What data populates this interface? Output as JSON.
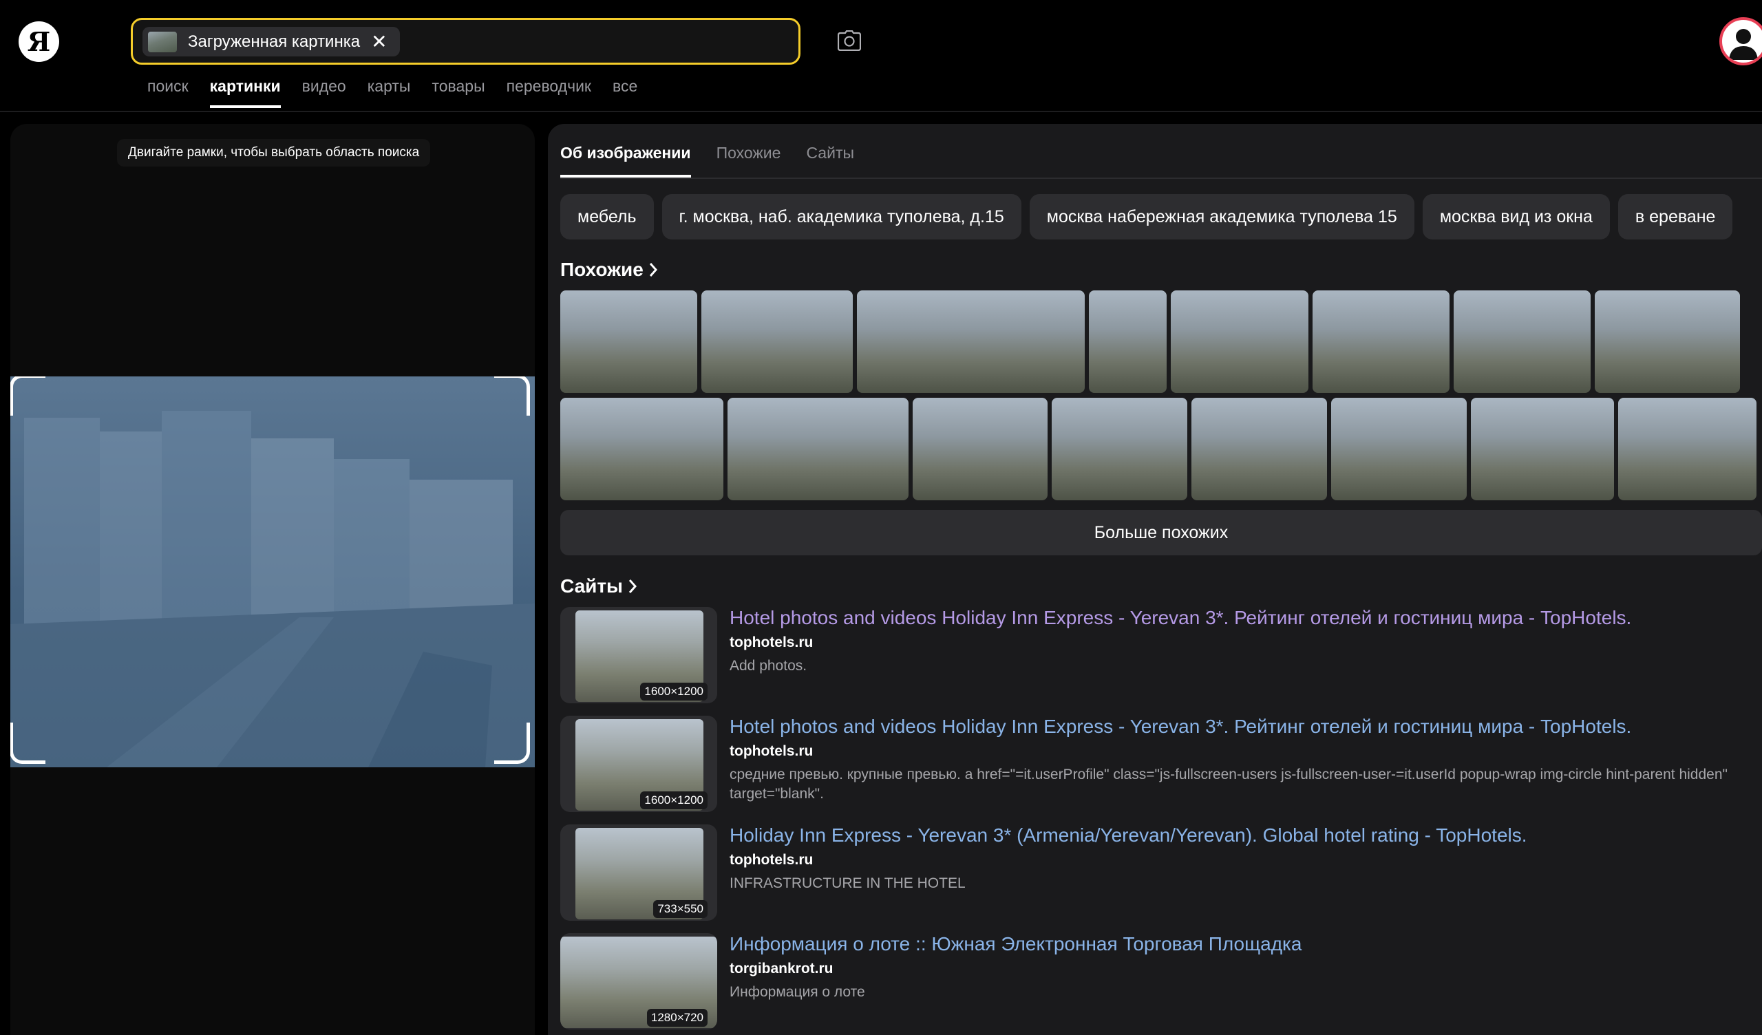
{
  "header": {
    "logo": "Я",
    "search_chip_label": "Загруженная картинка",
    "search_chip_close": "✕"
  },
  "nav": {
    "items": [
      "поиск",
      "картинки",
      "видео",
      "карты",
      "товары",
      "переводчик",
      "все"
    ],
    "active": "картинки"
  },
  "left_panel": {
    "hint": "Двигайте рамки, чтобы выбрать область поиска"
  },
  "tabs": {
    "items": [
      "Об изображении",
      "Похожие",
      "Сайты"
    ],
    "active": "Об изображении"
  },
  "tags": [
    "мебель",
    "г. москва, наб. академика туполева, д.15",
    "москва набережная академика туполева 15",
    "москва вид из окна",
    "в ереване"
  ],
  "similar": {
    "title": "Похожие",
    "more_label": "Больше похожих"
  },
  "sites": {
    "title": "Сайты",
    "items": [
      {
        "title": "Hotel photos and videos Holiday Inn Express - Yerevan 3*. Рейтинг отелей и гостиниц мира - TopHotels.",
        "domain": "tophotels.ru",
        "description": "Add photos.",
        "size": "1600×1200",
        "visited": true
      },
      {
        "title": "Hotel photos and videos Holiday Inn Express - Yerevan 3*. Рейтинг отелей и гостиниц мира - TopHotels.",
        "domain": "tophotels.ru",
        "description": "средние превью. крупные превью. a href=\"=it.userProfile\" class=\"js-fullscreen-users js-fullscreen-user-=it.userId popup-wrap img-circle hint-parent hidden\" target=\"blank\".",
        "size": "1600×1200",
        "visited": false
      },
      {
        "title": "Holiday Inn Express - Yerevan 3* (Armenia/Yerevan/Yerevan). Global hotel rating - TopHotels.",
        "domain": "tophotels.ru",
        "description": "INFRASTRUCTURE IN THE HOTEL",
        "size": "733×550",
        "visited": false
      },
      {
        "title": "Информация о лоте :: Южная Электронная Торговая Площадка",
        "domain": "torgibankrot.ru",
        "description": "Информация о лоте",
        "size": "1280×720",
        "visited": false
      }
    ]
  },
  "colors": {
    "search_border": "#f5cd2a",
    "link": "#8ab4e8",
    "visited_link": "#b59ae6",
    "avatar_ring": "#e83f55",
    "selection_overlay": "#4a6886"
  },
  "icons": {
    "camera": "camera-icon",
    "chevron": "chevron-right-icon",
    "avatar": "user-avatar-icon",
    "close": "close-icon"
  }
}
